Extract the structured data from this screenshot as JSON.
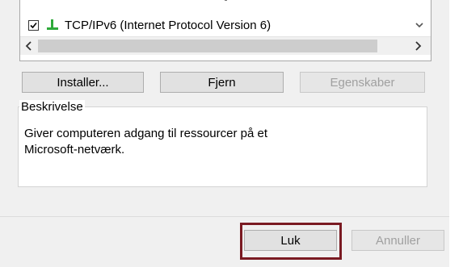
{
  "list": {
    "items": [
      {
        "label": "TCP/IPv6 (Internet Protocol Version 6)",
        "checked": true,
        "icon": "network-protocol-icon"
      }
    ]
  },
  "buttons": {
    "install": "Installer...",
    "remove": "Fjern",
    "properties": "Egenskaber"
  },
  "description": {
    "legend": "Beskrivelse",
    "text": "Giver computeren adgang til ressourcer på et\nMicrosoft-netværk."
  },
  "footer": {
    "close": "Luk",
    "cancel": "Annuller"
  },
  "colors": {
    "highlight": "#7a1a22",
    "icon_green": "#2eaa3a"
  }
}
